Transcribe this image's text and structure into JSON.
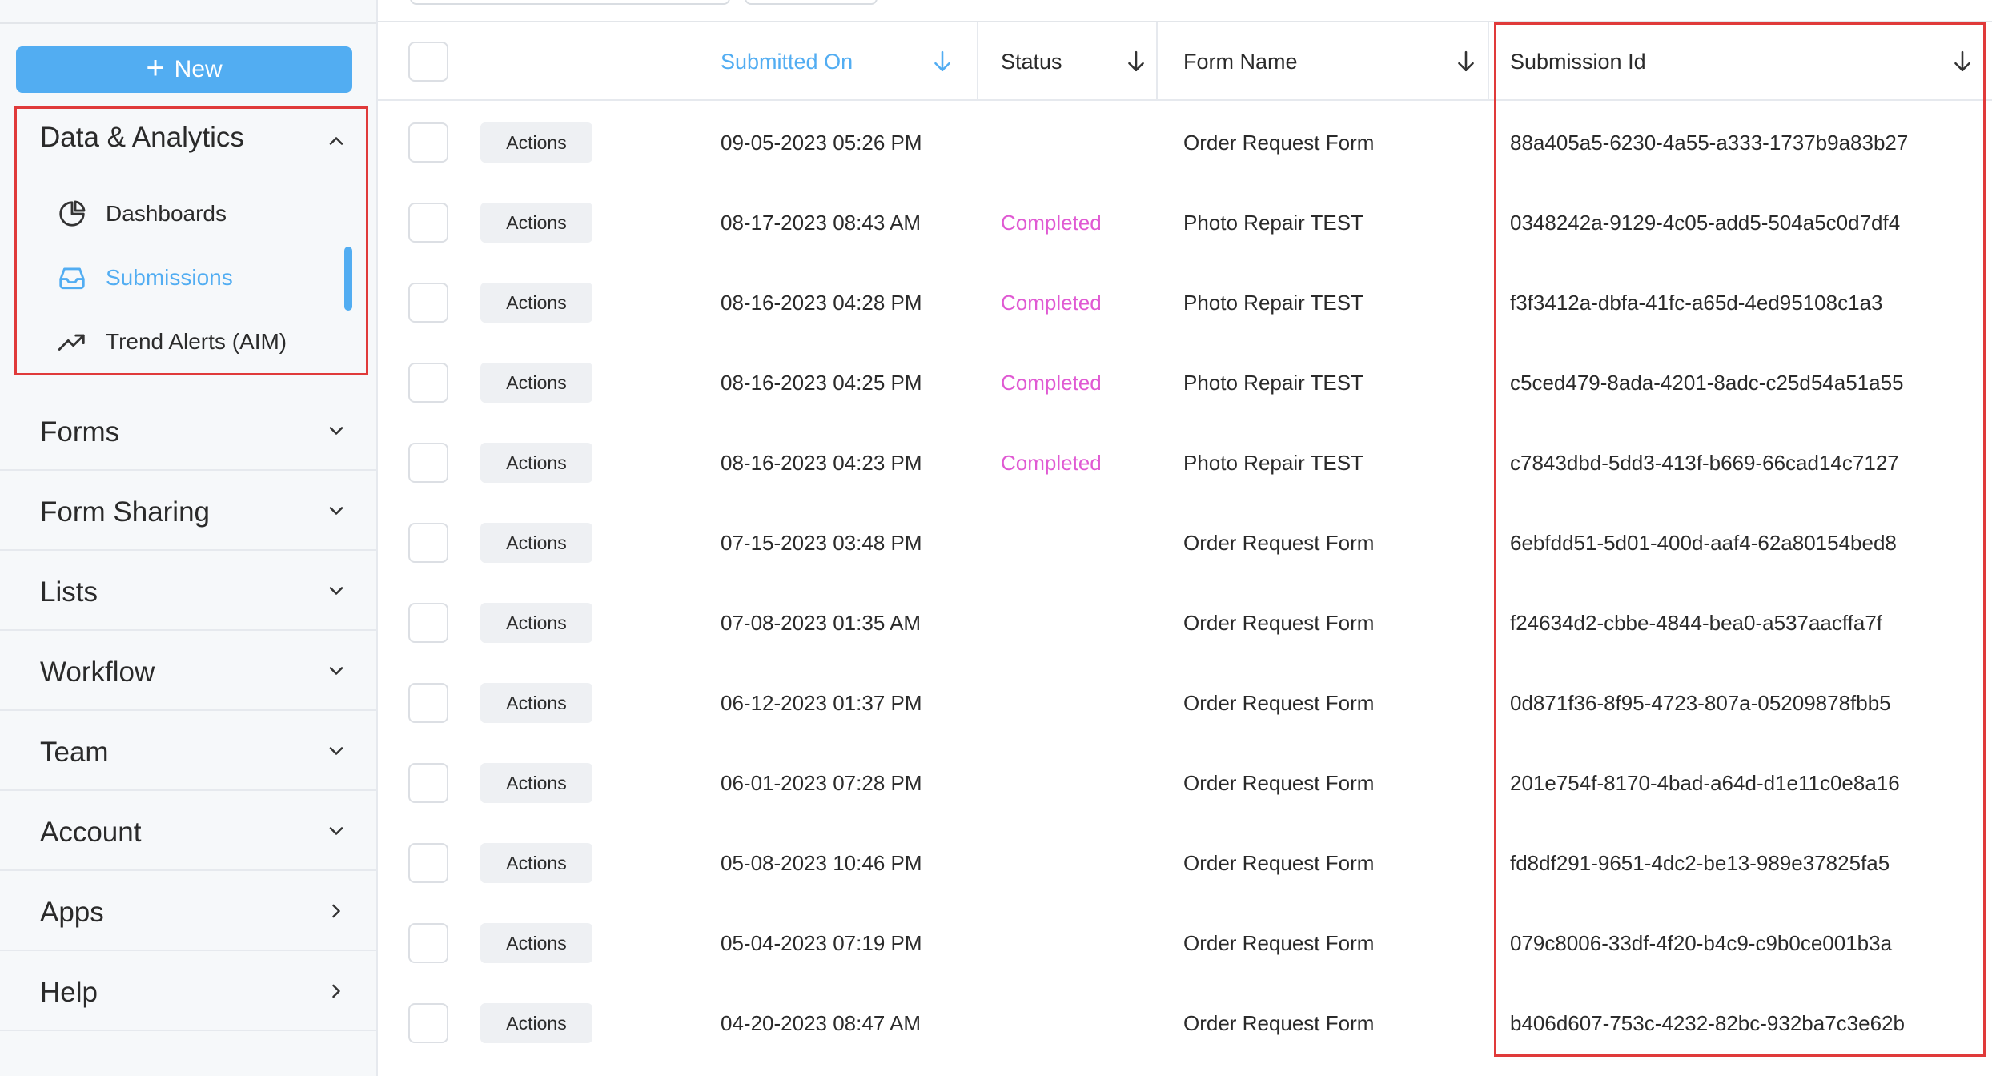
{
  "sidebar": {
    "new_button_label": "New",
    "analytics": {
      "title": "Data & Analytics",
      "items": [
        {
          "label": "Dashboards",
          "icon": "pie-chart-icon"
        },
        {
          "label": "Submissions",
          "icon": "inbox-icon",
          "active": true
        },
        {
          "label": "Trend Alerts (AIM)",
          "icon": "trending-up-icon"
        }
      ]
    },
    "sections": [
      {
        "title": "Forms",
        "chevron": "chevron-down-icon"
      },
      {
        "title": "Form Sharing",
        "chevron": "chevron-down-icon"
      },
      {
        "title": "Lists",
        "chevron": "chevron-down-icon"
      },
      {
        "title": "Workflow",
        "chevron": "chevron-down-icon"
      },
      {
        "title": "Team",
        "chevron": "chevron-down-icon"
      },
      {
        "title": "Account",
        "chevron": "chevron-down-icon"
      },
      {
        "title": "Apps",
        "chevron": "chevron-right-icon"
      },
      {
        "title": "Help",
        "chevron": "chevron-right-icon"
      }
    ]
  },
  "table": {
    "columns": {
      "submitted_on": "Submitted On",
      "status": "Status",
      "form_name": "Form Name",
      "submission_id": "Submission Id"
    },
    "sorted_column": "submitted_on",
    "action_label": "Actions",
    "rows": [
      {
        "submitted_on": "09-05-2023 05:26 PM",
        "status": "",
        "form_name": "Order Request Form",
        "submission_id": "88a405a5-6230-4a55-a333-1737b9a83b27"
      },
      {
        "submitted_on": "08-17-2023 08:43 AM",
        "status": "Completed",
        "form_name": "Photo Repair TEST",
        "submission_id": "0348242a-9129-4c05-add5-504a5c0d7df4"
      },
      {
        "submitted_on": "08-16-2023 04:28 PM",
        "status": "Completed",
        "form_name": "Photo Repair TEST",
        "submission_id": "f3f3412a-dbfa-41fc-a65d-4ed95108c1a3"
      },
      {
        "submitted_on": "08-16-2023 04:25 PM",
        "status": "Completed",
        "form_name": "Photo Repair TEST",
        "submission_id": "c5ced479-8ada-4201-8adc-c25d54a51a55"
      },
      {
        "submitted_on": "08-16-2023 04:23 PM",
        "status": "Completed",
        "form_name": "Photo Repair TEST",
        "submission_id": "c7843dbd-5dd3-413f-b669-66cad14c7127"
      },
      {
        "submitted_on": "07-15-2023 03:48 PM",
        "status": "",
        "form_name": "Order Request Form",
        "submission_id": "6ebfdd51-5d01-400d-aaf4-62a80154bed8"
      },
      {
        "submitted_on": "07-08-2023 01:35 AM",
        "status": "",
        "form_name": "Order Request Form",
        "submission_id": "f24634d2-cbbe-4844-bea0-a537aacffa7f"
      },
      {
        "submitted_on": "06-12-2023 01:37 PM",
        "status": "",
        "form_name": "Order Request Form",
        "submission_id": "0d871f36-8f95-4723-807a-05209878fbb5"
      },
      {
        "submitted_on": "06-01-2023 07:28 PM",
        "status": "",
        "form_name": "Order Request Form",
        "submission_id": "201e754f-8170-4bad-a64d-d1e11c0e8a16"
      },
      {
        "submitted_on": "05-08-2023 10:46 PM",
        "status": "",
        "form_name": "Order Request Form",
        "submission_id": "fd8df291-9651-4dc2-be13-989e37825fa5"
      },
      {
        "submitted_on": "05-04-2023 07:19 PM",
        "status": "",
        "form_name": "Order Request Form",
        "submission_id": "079c8006-33df-4f20-b4c9-c9b0ce001b3a"
      },
      {
        "submitted_on": "04-20-2023 08:47 AM",
        "status": "",
        "form_name": "Order Request Form",
        "submission_id": "b406d607-753c-4232-82bc-932ba7c3e62b"
      }
    ]
  },
  "colors": {
    "accent": "#52adf2",
    "status_completed": "#e05ad3",
    "highlight": "#e03a3a"
  }
}
